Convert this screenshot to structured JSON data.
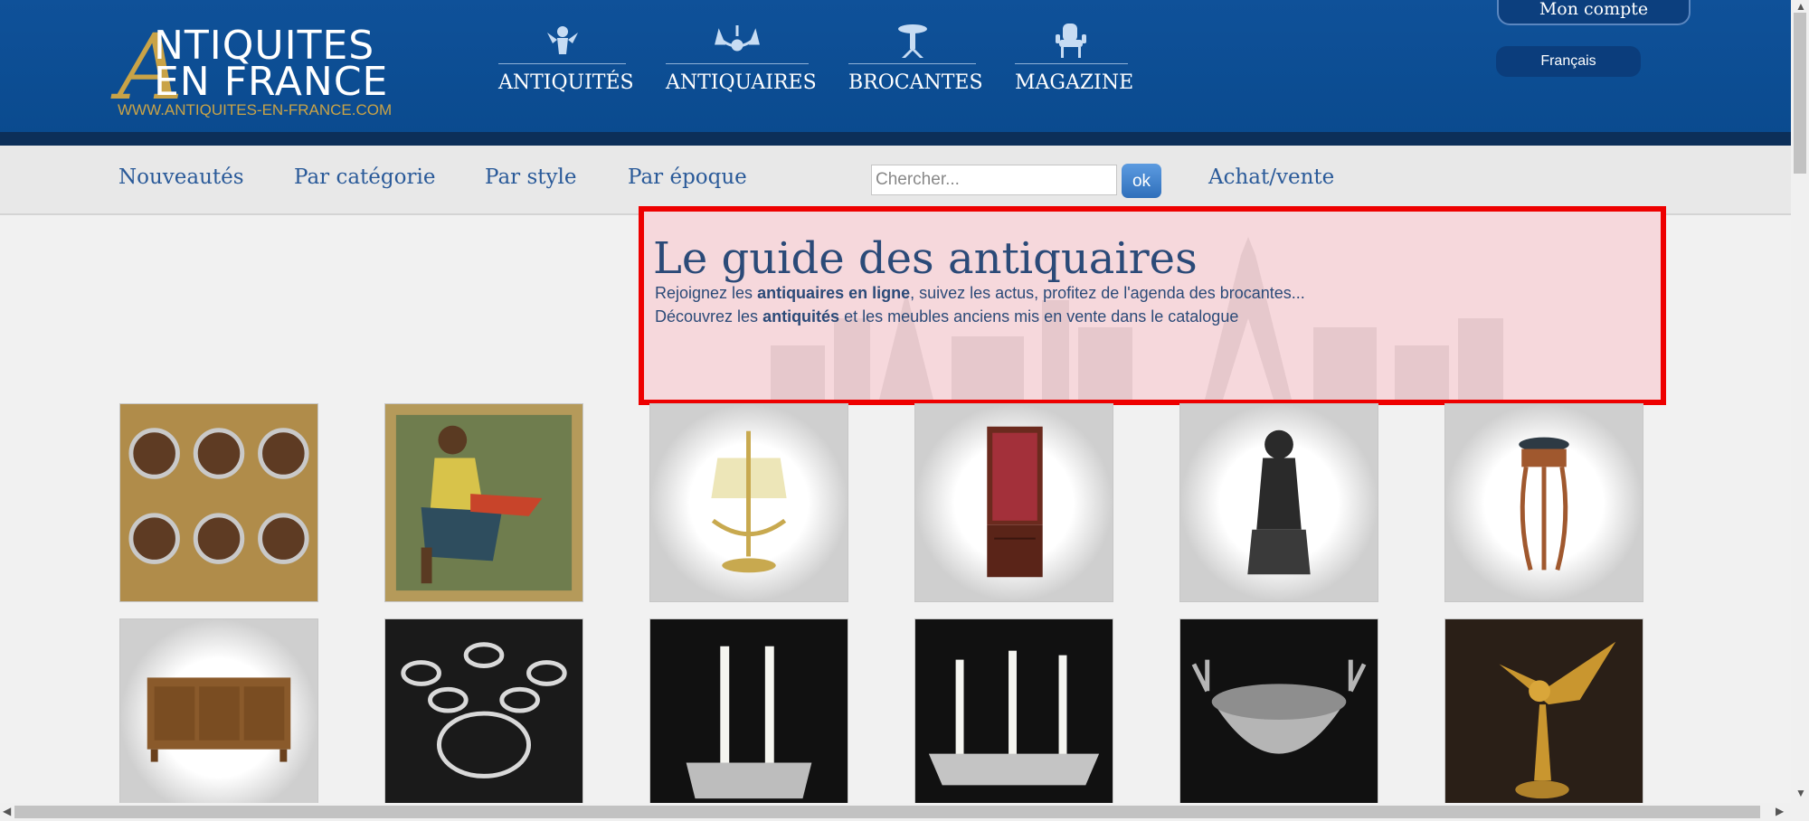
{
  "brand": {
    "initial": "A",
    "line1": "NTIQUITES",
    "line2": "EN FRANCE",
    "url": "WWW.ANTIQUITES-EN-FRANCE.COM"
  },
  "main_nav": [
    {
      "label": "ANTIQUITÉS",
      "icon": "cherub-icon"
    },
    {
      "label": "ANTIQUAIRES",
      "icon": "chandelier-icon"
    },
    {
      "label": "BROCANTES",
      "icon": "gueridon-table-icon"
    },
    {
      "label": "MAGAZINE",
      "icon": "armchair-icon"
    }
  ],
  "account": {
    "label": "Mon compte"
  },
  "language": {
    "label": "Français"
  },
  "sub_nav": {
    "items": [
      "Nouveautés",
      "Par catégorie",
      "Par style",
      "Par époque"
    ],
    "search_placeholder": "Chercher...",
    "ok_label": "ok",
    "buy_sell": "Achat/vente"
  },
  "guide": {
    "title": "Le guide des antiquaires",
    "line1_a": "Rejoignez les ",
    "line1_b": "antiquaires en ligne",
    "line1_c": ", suivez les actus, profitez de l'agenda des brocantes...",
    "line2_a": "Découvrez les ",
    "line2_b": "antiquités",
    "line2_c": " et les meubles anciens mis en vente dans le catalogue"
  },
  "products": [
    {
      "name": "six-silver-plates-thumbnail",
      "colors": [
        "#b08c4a",
        "#5e3b23"
      ]
    },
    {
      "name": "painting-seated-woman-thumbnail",
      "colors": [
        "#c9b25a",
        "#3c5a4a"
      ]
    },
    {
      "name": "bouillotte-lamp-thumbnail",
      "colors": [
        "#ffffff",
        "#c8a94f"
      ]
    },
    {
      "name": "vitrine-cabinet-thumbnail",
      "colors": [
        "#ffffff",
        "#6b2a1e"
      ]
    },
    {
      "name": "bronze-statue-thumbnail",
      "colors": [
        "#ffffff",
        "#2a2a2a"
      ]
    },
    {
      "name": "pedestal-table-thumbnail",
      "colors": [
        "#ffffff",
        "#a0582e"
      ]
    },
    {
      "name": "sideboard-thumbnail",
      "colors": [
        "#ffffff",
        "#8a5a2b"
      ]
    },
    {
      "name": "crystal-candelabra-thumbnail",
      "colors": [
        "#1a1a1a",
        "#d9d9d9"
      ]
    },
    {
      "name": "two-candle-holder-thumbnail",
      "colors": [
        "#111111",
        "#bdbdbd"
      ]
    },
    {
      "name": "three-candle-tray-thumbnail",
      "colors": [
        "#111111",
        "#c4c4c4"
      ]
    },
    {
      "name": "silver-bowl-antlers-thumbnail",
      "colors": [
        "#111111",
        "#b5b5b5"
      ]
    },
    {
      "name": "gilded-eagle-thumbnail",
      "colors": [
        "#2a1f17",
        "#c9962f"
      ]
    }
  ]
}
